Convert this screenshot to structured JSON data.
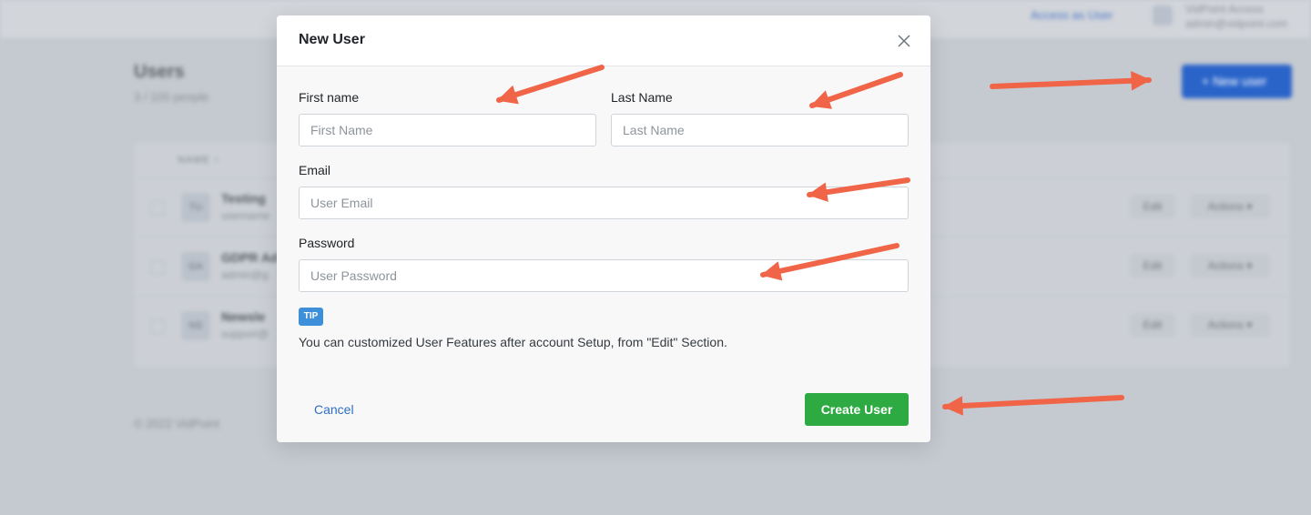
{
  "background": {
    "topbar": {
      "login_as_label": "Access as User",
      "user_initials": "AD",
      "user_name": "VidPoint Access",
      "user_email": "admin@vidpoint.com"
    },
    "page_title": "Users",
    "page_subtitle": "3 / 100 people",
    "new_user_label": "+ New user",
    "table": {
      "column_name": "NAME ↑",
      "rows": [
        {
          "initials": "TU",
          "name": "Testing",
          "email": "username",
          "edit": "Edit",
          "actions": "Actions ▾"
        },
        {
          "initials": "GA",
          "name": "GDPR Ad",
          "email": "admin@g",
          "edit": "Edit",
          "actions": "Actions ▾"
        },
        {
          "initials": "NS",
          "name": "Newsle",
          "email": "support@",
          "edit": "Edit",
          "actions": "Actions ▾"
        }
      ]
    },
    "footer": "© 2022 VidPoint"
  },
  "modal": {
    "title": "New User",
    "fields": {
      "first_name": {
        "label": "First name",
        "placeholder": "First Name",
        "value": ""
      },
      "last_name": {
        "label": "Last Name",
        "placeholder": "Last Name",
        "value": ""
      },
      "email": {
        "label": "Email",
        "placeholder": "User Email",
        "value": ""
      },
      "password": {
        "label": "Password",
        "placeholder": "User Password",
        "value": ""
      }
    },
    "tip_badge": "TIP",
    "tip_text": "You can customized User Features after account Setup, from \"Edit\" Section.",
    "cancel_label": "Cancel",
    "submit_label": "Create User"
  },
  "colors": {
    "overlay": "#c5c9d0",
    "primary_button": "#2eaa43",
    "link": "#2f6fc5",
    "tip_badge": "#3d8fd9",
    "annotation_arrow": "#f06548"
  },
  "icons": [
    "close-icon",
    "arrow-annotation-icon"
  ]
}
